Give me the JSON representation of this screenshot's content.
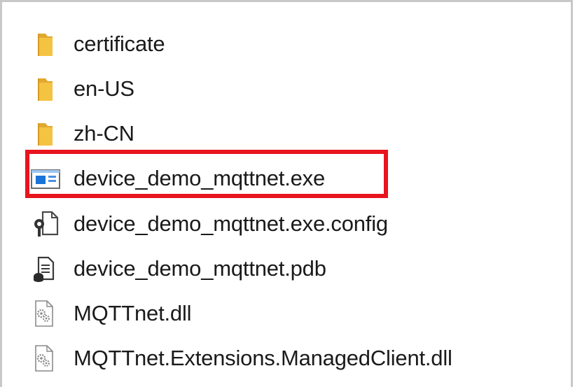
{
  "files": [
    {
      "name": "certificate",
      "icon": "folder-icon"
    },
    {
      "name": "en-US",
      "icon": "folder-icon"
    },
    {
      "name": "zh-CN",
      "icon": "folder-icon"
    },
    {
      "name": "device_demo_mqttnet.exe",
      "icon": "application-icon"
    },
    {
      "name": "device_demo_mqttnet.exe.config",
      "icon": "config-file-icon"
    },
    {
      "name": "device_demo_mqttnet.pdb",
      "icon": "pdb-file-icon"
    },
    {
      "name": "MQTTnet.dll",
      "icon": "dll-file-icon"
    },
    {
      "name": "MQTTnet.Extensions.ManagedClient.dll",
      "icon": "dll-file-icon"
    }
  ],
  "highlight": {
    "target": "device_demo_mqttnet.exe",
    "color": "#e8141e"
  },
  "colors": {
    "folder": "#f5c342",
    "folder_dark": "#e0a82e",
    "app_blue": "#1a73d9"
  }
}
